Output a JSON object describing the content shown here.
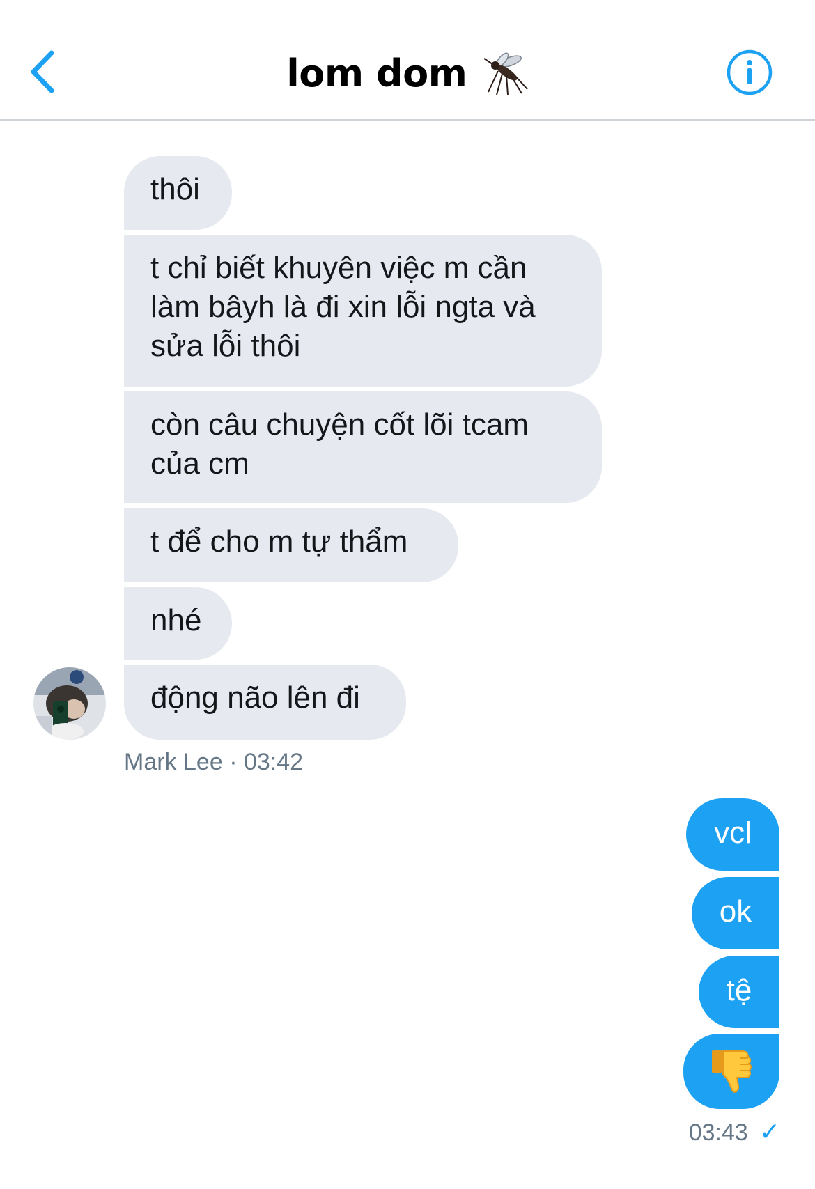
{
  "header": {
    "title": "lom dom",
    "title_emoji": "mosquito-icon",
    "back_icon": "chevron-left-icon",
    "info_icon": "info-icon"
  },
  "incoming": {
    "messages": [
      "thôi",
      "t chỉ biết khuyên việc m cần làm bâyh là đi xin lỗi ngta và sửa lỗi thôi",
      "còn câu chuyện cốt lõi tcam của cm",
      "t để cho m tự thẩm",
      "nhé",
      "động não lên đi"
    ],
    "sender": "Mark Lee",
    "separator": "·",
    "time": "03:42"
  },
  "outgoing": {
    "messages": [
      "vcl",
      "ok",
      "tệ",
      "thumbs-down-emoji"
    ],
    "time": "03:43",
    "status_icon": "check-icon"
  },
  "colors": {
    "accent": "#1da1f2",
    "incoming_bubble": "#e6e9ef",
    "meta_text": "#657786"
  }
}
